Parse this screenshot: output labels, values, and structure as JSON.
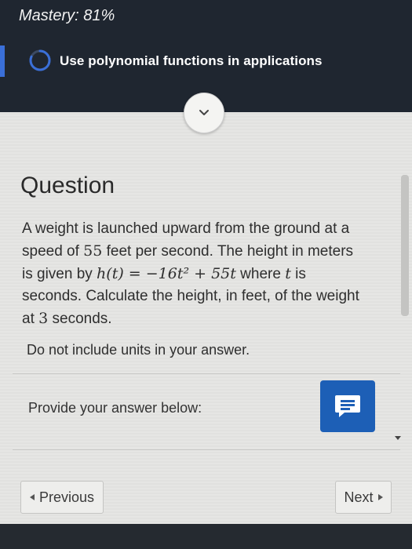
{
  "header": {
    "mastery_label": "Mastery: 81%",
    "mastery_percent": 81,
    "topic": "Use polynomial functions in applications"
  },
  "question": {
    "title": "Question",
    "line1": "A weight is launched upward from the ground at a",
    "line2_a": "speed of ",
    "line2_num": "55",
    "line2_b": " feet per second. The height in meters",
    "line3_a": "is given by ",
    "line3_math": "h(t) = −16t² + 55t",
    "line3_b": " where ",
    "line3_var": "t",
    "line3_c": " is",
    "line4": "seconds. Calculate the height, in feet, of the weight",
    "line5_a": "at ",
    "line5_num": "3",
    "line5_b": " seconds.",
    "instruction": "Do not include units in your answer."
  },
  "answer": {
    "prompt": "Provide your answer below:"
  },
  "nav": {
    "previous_label": "Previous",
    "next_label": "Next"
  },
  "colors": {
    "header_bg": "#1f2630",
    "accent_blue": "#1d5fb6",
    "progress_blue": "#3a6fd8"
  }
}
